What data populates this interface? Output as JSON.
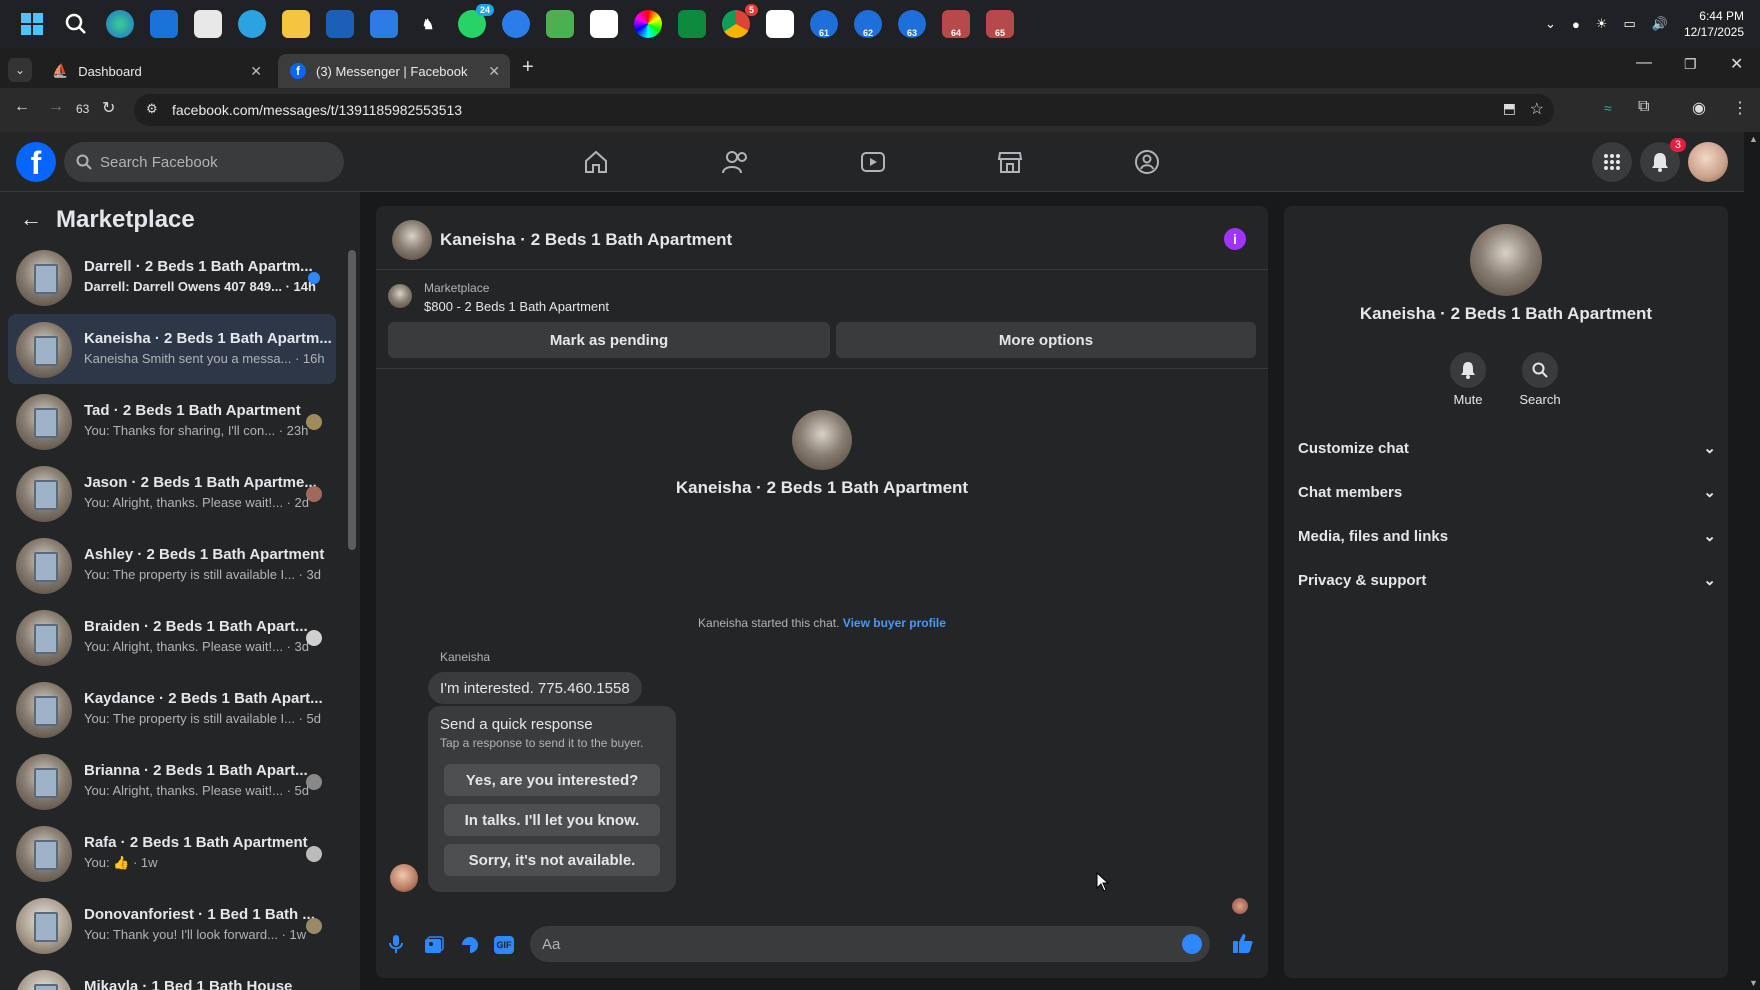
{
  "taskbar": {
    "badges": {
      "whatsapp": "24",
      "chrome": "5"
    },
    "edge_profiles": [
      "61",
      "62",
      "63",
      "64",
      "65"
    ],
    "time": "6:44 PM",
    "date": "12/17/2025"
  },
  "browser": {
    "tabs": [
      {
        "title": "Dashboard",
        "active": false
      },
      {
        "title": "(3) Messenger | Facebook",
        "active": true
      }
    ],
    "history_count": "63",
    "url": "facebook.com/messages/t/1391185982553513"
  },
  "fb_header": {
    "search_placeholder": "Search Facebook",
    "notifications_count": "3"
  },
  "left": {
    "title": "Marketplace",
    "conversations": [
      {
        "name": "Darrell · 2 Beds 1 Bath Apartm...",
        "snippet": "Darrell: Darrell Owens 407 849... · 14h",
        "unread": true
      },
      {
        "name": "Kaneisha · 2 Beds 1 Bath Apartm...",
        "snippet": "Kaneisha Smith sent you a messa... · 16h",
        "active": true
      },
      {
        "name": "Tad · 2 Beds 1 Bath Apartment",
        "snippet": "You: Thanks for sharing, I'll con... · 23h"
      },
      {
        "name": "Jason · 2 Beds 1 Bath Apartme...",
        "snippet": "You: Alright, thanks. Please wait!... · 2d"
      },
      {
        "name": "Ashley · 2 Beds 1 Bath Apartment",
        "snippet": "You: The property is still available I... · 3d"
      },
      {
        "name": "Braiden · 2 Beds 1 Bath Apart...",
        "snippet": "You: Alright, thanks. Please wait!... · 3d"
      },
      {
        "name": "Kaydance · 2 Beds 1 Bath Apart...",
        "snippet": "You: The property is still available I... · 5d"
      },
      {
        "name": "Brianna · 2 Beds 1 Bath Apart...",
        "snippet": "You: Alright, thanks. Please wait!... · 5d"
      },
      {
        "name": "Rafa · 2 Beds 1 Bath Apartment",
        "snippet": "You: 👍 · 1w"
      },
      {
        "name": "Donovanforiest · 1 Bed 1 Bath ...",
        "snippet": "You: Thank you! I'll look forward... · 1w"
      },
      {
        "name": "Mikayla · 1 Bed 1 Bath House",
        "snippet": ""
      }
    ]
  },
  "chat": {
    "title": "Kaneisha · 2 Beds 1 Bath Apartment",
    "listing_source": "Marketplace",
    "listing_detail": "$800 - 2 Beds 1 Bath Apartment",
    "mark_pending": "Mark as pending",
    "more_options": "More options",
    "center_name": "Kaneisha · 2 Beds 1 Bath Apartment",
    "started_text": "Kaneisha started this chat.",
    "view_profile": "View buyer profile",
    "sender": "Kaneisha",
    "message": "I'm interested. 775.460.1558",
    "quick_title": "Send a quick response",
    "quick_sub": "Tap a response to send it to the buyer.",
    "quick_replies": [
      "Yes, are you interested?",
      "In talks. I'll let you know.",
      "Sorry, it's not available."
    ],
    "input_placeholder": "Aa"
  },
  "info": {
    "name": "Kaneisha · 2 Beds 1 Bath Apartment",
    "mute": "Mute",
    "search": "Search",
    "sections": [
      "Customize chat",
      "Chat members",
      "Media, files and links",
      "Privacy & support"
    ]
  },
  "colors": {
    "accent": "#2d88ff",
    "fb_blue": "#0866ff",
    "info_purple": "#a033ff"
  }
}
